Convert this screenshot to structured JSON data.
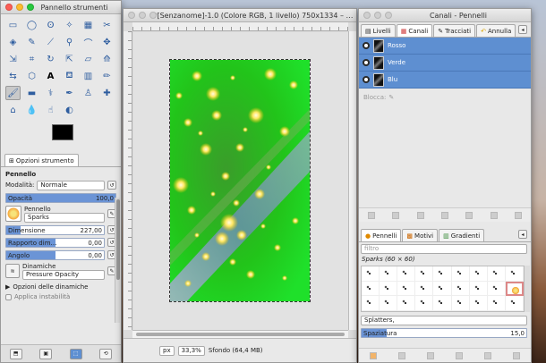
{
  "toolbox": {
    "title": "Pannello strumenti",
    "tab_label": "Opzioni strumento",
    "tool_name": "Pennello",
    "mode_label": "Modalità:",
    "mode_value": "Normale",
    "opacity": {
      "label": "Opacità",
      "value": "100,0",
      "level": 1.0
    },
    "brush_label": "Pennello",
    "brush_value": "Sparks",
    "size": {
      "label": "Dimensione",
      "value": "227,00",
      "level": 0.15
    },
    "ratio": {
      "label": "Rapporto dim…",
      "value": "0,00",
      "level": 0.5
    },
    "angle": {
      "label": "Angolo",
      "value": "0,00",
      "level": 0.5
    },
    "dynamics_label": "Dinamiche",
    "dynamics_value": "Pressure Opacity",
    "dynamics_options": "Opzioni delle dinamiche",
    "cut_label": "Applica instabilità"
  },
  "image_window": {
    "title": "*[Senzanome]-1.0 (Colore RGB, 1 livello) 750x1334 – …",
    "unit": "px",
    "zoom": "33,3%",
    "status": "Sfondo (64,4 MB)"
  },
  "layers_window": {
    "title": "Canali - Pennelli",
    "tabs": [
      "Livelli",
      "Canali",
      "Tracciati",
      "Annulla"
    ],
    "channels": [
      "Rosso",
      "Verde",
      "Blu"
    ],
    "lock_label": "Blocca:",
    "brush_tabs": [
      "Pennelli",
      "Motivi",
      "Gradienti"
    ],
    "filter_placeholder": "filtro",
    "brush_set_label": "Sparks (60 × 60)",
    "brush_tag": "Splatters,",
    "spacing": {
      "label": "Spaziatura",
      "value": "15,0",
      "level": 0.15
    }
  },
  "colors": {
    "selection": "#5e8fd1",
    "foreground": "#000000",
    "background": "#ffffff"
  }
}
